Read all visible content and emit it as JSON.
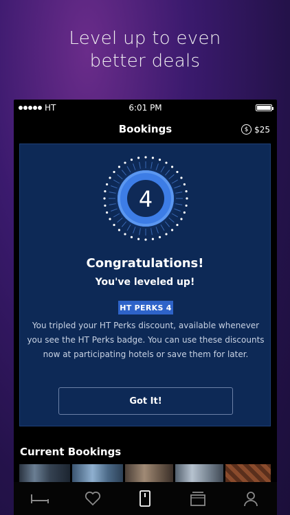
{
  "promo": {
    "headline_line1": "Level up to even",
    "headline_line2": "better deals"
  },
  "status_bar": {
    "carrier": "HT",
    "time": "6:01 PM"
  },
  "nav": {
    "title": "Bookings",
    "credit_icon": "dollar-coin-icon",
    "credit_symbol": "$",
    "credit": "$25"
  },
  "level_card": {
    "level": "4",
    "title": "Congratulations!",
    "subtitle": "You've leveled up!",
    "tag": "HT PERKS 4",
    "description": "You tripled your HT Perks discount, available whenever you see the HT Perks badge. You can use these discounts now at participating hotels or save them for later.",
    "button": "Got It!"
  },
  "bookings": {
    "section_title": "Current Bookings"
  },
  "tabs": [
    {
      "icon": "bed-icon",
      "active": false
    },
    {
      "icon": "heart-icon",
      "active": false
    },
    {
      "icon": "phone-icon",
      "active": true
    },
    {
      "icon": "ticket-icon",
      "active": false
    },
    {
      "icon": "user-icon",
      "active": false
    }
  ],
  "colors": {
    "card_bg": "#0d2956",
    "accent": "#2e63c9",
    "tab_active": "#ffffff",
    "tab_inactive": "#8a8a8a"
  }
}
